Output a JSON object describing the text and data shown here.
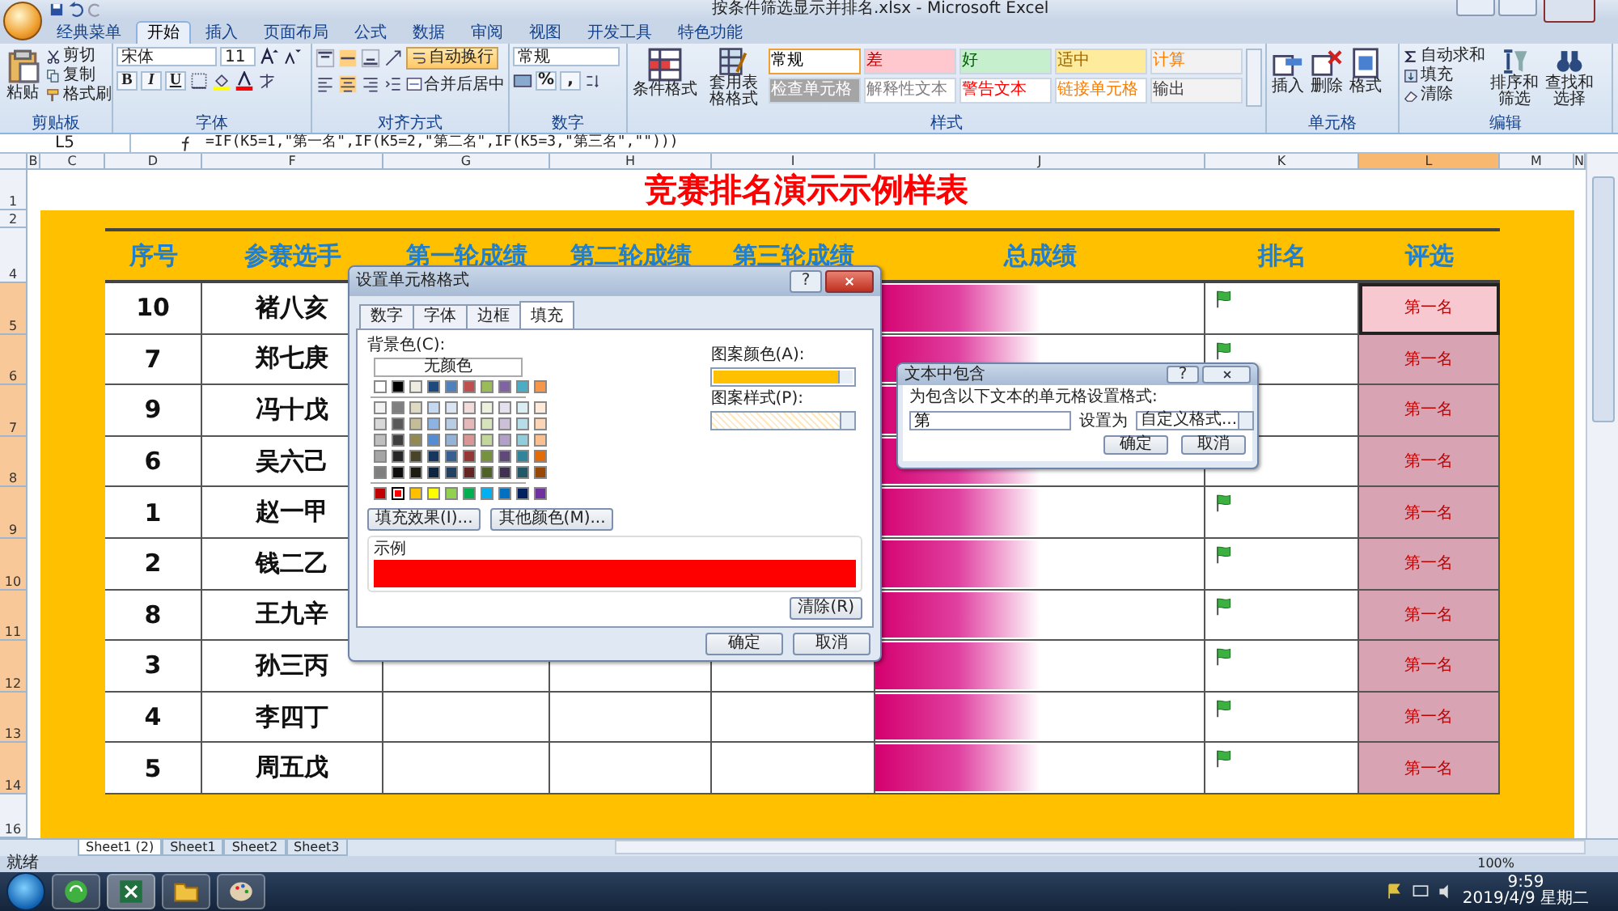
{
  "window": {
    "title": "按条件筛选显示并排名.xlsx - Microsoft Excel"
  },
  "tabs": [
    {
      "label": "经典菜单",
      "selected": false
    },
    {
      "label": "开始",
      "selected": true
    },
    {
      "label": "插入",
      "selected": false
    },
    {
      "label": "页面布局",
      "selected": false
    },
    {
      "label": "公式",
      "selected": false
    },
    {
      "label": "数据",
      "selected": false
    },
    {
      "label": "审阅",
      "selected": false
    },
    {
      "label": "视图",
      "selected": false
    },
    {
      "label": "开发工具",
      "selected": false
    },
    {
      "label": "特色功能",
      "selected": false
    }
  ],
  "ribbon": {
    "clipboard": {
      "label": "剪贴板",
      "paste": "粘贴",
      "items": [
        "剪切",
        "复制",
        "格式刷"
      ]
    },
    "font": {
      "label": "字体",
      "font": "宋体",
      "size": "11",
      "buttons": [
        "B",
        "I",
        "U"
      ]
    },
    "align": {
      "label": "对齐方式",
      "wrap": {
        "label": "自动换行",
        "on": true
      },
      "merge": "合并后居中"
    },
    "number": {
      "label": "数字",
      "format": "常规",
      "buttons": [
        "%",
        ","
      ]
    },
    "styles": {
      "label": "样式",
      "big": [
        "条件格式",
        "套用表格格式"
      ],
      "gallery": [
        {
          "label": "常规",
          "kind": "normal",
          "color": "#ffffff",
          "selected": true
        },
        {
          "label": "差",
          "kind": "bad",
          "color": "#ffc7ce",
          "selected": false
        },
        {
          "label": "好",
          "kind": "good",
          "color": "#c6efce",
          "selected": false
        },
        {
          "label": "适中",
          "kind": "neutral",
          "color": "#ffeb9c",
          "selected": false
        },
        {
          "label": "计算",
          "kind": "calculation",
          "color": "#f2f2f2",
          "selected": false
        },
        {
          "label": "检查单元格",
          "kind": "check",
          "color": "#a5a5a5",
          "selected": false
        },
        {
          "label": "解释性文本",
          "kind": "explanatory",
          "color": "#ffffff",
          "selected": false
        },
        {
          "label": "警告文本",
          "kind": "warning",
          "color": "#ffffff",
          "selected": false
        },
        {
          "label": "链接单元格",
          "kind": "linked",
          "color": "#ffffff",
          "selected": false
        },
        {
          "label": "输出",
          "kind": "output",
          "color": "#f2f2f2",
          "selected": false
        }
      ]
    },
    "cells": {
      "label": "单元格",
      "big": [
        "插入",
        "删除",
        "格式"
      ]
    },
    "editing": {
      "label": "编辑",
      "items": [
        "自动求和",
        "填充",
        "清除"
      ],
      "big": [
        "排序和筛选",
        "查找和选择"
      ]
    }
  },
  "formula_bar": {
    "name_box": "L5",
    "formula": "=IF(K5=1,\"第一名\",IF(K5=2,\"第二名\",IF(K5=3,\"第三名\",\"\")))"
  },
  "sheet": {
    "column_headers": [
      {
        "label": "B",
        "selected": false
      },
      {
        "label": "C",
        "selected": false
      },
      {
        "label": "D",
        "selected": false
      },
      {
        "label": "F",
        "selected": false
      },
      {
        "label": "G",
        "selected": false
      },
      {
        "label": "H",
        "selected": false
      },
      {
        "label": "I",
        "selected": false
      },
      {
        "label": "J",
        "selected": false
      },
      {
        "label": "K",
        "selected": false
      },
      {
        "label": "L",
        "selected": true
      },
      {
        "label": "M",
        "selected": false
      },
      {
        "label": "N",
        "selected": false
      }
    ],
    "row_headers": [
      {
        "label": "1",
        "selected": false
      },
      {
        "label": "2",
        "selected": false
      },
      {
        "label": "4",
        "selected": false
      },
      {
        "label": "5",
        "selected": true
      },
      {
        "label": "6",
        "selected": true
      },
      {
        "label": "7",
        "selected": true
      },
      {
        "label": "8",
        "selected": true
      },
      {
        "label": "9",
        "selected": true
      },
      {
        "label": "10",
        "selected": true
      },
      {
        "label": "11",
        "selected": true
      },
      {
        "label": "12",
        "selected": true
      },
      {
        "label": "13",
        "selected": true
      },
      {
        "label": "14",
        "selected": true
      },
      {
        "label": "16",
        "selected": false
      }
    ],
    "title": "竞赛排名演示示例样表",
    "columns": [
      "序号",
      "参赛选手",
      "第一轮成绩",
      "第二轮成绩",
      "第三轮成绩",
      "总成绩",
      "排名",
      "评选"
    ],
    "rows": [
      {
        "no": "10",
        "name": "褚八亥",
        "level": 0.5,
        "rating": "第一名",
        "selected": true
      },
      {
        "no": "7",
        "name": "郑七庚",
        "level": 0.5,
        "rating": "第一名",
        "selected": false
      },
      {
        "no": "9",
        "name": "冯十戊",
        "level": 0.5,
        "rating": "第一名",
        "selected": false
      },
      {
        "no": "6",
        "name": "吴六己",
        "level": 0.5,
        "rating": "第一名",
        "selected": false
      },
      {
        "no": "1",
        "name": "赵一甲",
        "level": 0.5,
        "rating": "第一名",
        "selected": false
      },
      {
        "no": "2",
        "name": "钱二乙",
        "level": 0.5,
        "rating": "第一名",
        "selected": false
      },
      {
        "no": "8",
        "name": "王九辛",
        "level": 0.5,
        "rating": "第一名",
        "selected": false
      },
      {
        "no": "3",
        "name": "孙三丙",
        "level": 0.5,
        "rating": "第一名",
        "selected": false
      },
      {
        "no": "4",
        "name": "李四丁",
        "level": 0.5,
        "rating": "第一名",
        "selected": false
      },
      {
        "no": "5",
        "name": "周五戊",
        "level": 0.5,
        "rating": "第一名",
        "selected": false
      }
    ]
  },
  "format_dialog": {
    "title": "设置单元格格式",
    "help": "?",
    "tabs": [
      {
        "label": "数字",
        "selected": false
      },
      {
        "label": "字体",
        "selected": false
      },
      {
        "label": "边框",
        "selected": false
      },
      {
        "label": "填充",
        "selected": true
      }
    ],
    "background_label": "背景色(C):",
    "no_color": "无颜色",
    "theme_colors": [
      {
        "color": "#ffffff",
        "selected": false
      },
      {
        "color": "#000000",
        "selected": false
      },
      {
        "color": "#eeece1",
        "selected": false
      },
      {
        "color": "#1f497d",
        "selected": false
      },
      {
        "color": "#4f81bd",
        "selected": false
      },
      {
        "color": "#c0504d",
        "selected": false
      },
      {
        "color": "#9bbb59",
        "selected": false
      },
      {
        "color": "#8064a2",
        "selected": false
      },
      {
        "color": "#4bacc6",
        "selected": false
      },
      {
        "color": "#f79646",
        "selected": false
      }
    ],
    "tints": [
      [
        {
          "color": "#f2f2f2",
          "selected": false
        },
        {
          "color": "#7f7f7f",
          "selected": false
        },
        {
          "color": "#ddd9c3",
          "selected": false
        },
        {
          "color": "#c6d9f0",
          "selected": false
        },
        {
          "color": "#dbe5f1",
          "selected": false
        },
        {
          "color": "#f2dcdb",
          "selected": false
        },
        {
          "color": "#ebf1dd",
          "selected": false
        },
        {
          "color": "#e5e0ec",
          "selected": false
        },
        {
          "color": "#dbeef3",
          "selected": false
        },
        {
          "color": "#fdeada",
          "selected": false
        }
      ],
      [
        {
          "color": "#d8d8d8",
          "selected": false
        },
        {
          "color": "#595959",
          "selected": false
        },
        {
          "color": "#c4bd97",
          "selected": false
        },
        {
          "color": "#8db3e2",
          "selected": false
        },
        {
          "color": "#b8cce4",
          "selected": false
        },
        {
          "color": "#e5b9b7",
          "selected": false
        },
        {
          "color": "#d7e3bc",
          "selected": false
        },
        {
          "color": "#ccc1d9",
          "selected": false
        },
        {
          "color": "#b7dde8",
          "selected": false
        },
        {
          "color": "#fbd5b5",
          "selected": false
        }
      ],
      [
        {
          "color": "#bfbfbf",
          "selected": false
        },
        {
          "color": "#3f3f3f",
          "selected": false
        },
        {
          "color": "#938953",
          "selected": false
        },
        {
          "color": "#548dd4",
          "selected": false
        },
        {
          "color": "#95b3d7",
          "selected": false
        },
        {
          "color": "#d99694",
          "selected": false
        },
        {
          "color": "#c3d69b",
          "selected": false
        },
        {
          "color": "#b2a2c7",
          "selected": false
        },
        {
          "color": "#92cddc",
          "selected": false
        },
        {
          "color": "#fac08f",
          "selected": false
        }
      ],
      [
        {
          "color": "#a5a5a5",
          "selected": false
        },
        {
          "color": "#262626",
          "selected": false
        },
        {
          "color": "#494429",
          "selected": false
        },
        {
          "color": "#17365d",
          "selected": false
        },
        {
          "color": "#366092",
          "selected": false
        },
        {
          "color": "#953734",
          "selected": false
        },
        {
          "color": "#76923c",
          "selected": false
        },
        {
          "color": "#5f497a",
          "selected": false
        },
        {
          "color": "#31859b",
          "selected": false
        },
        {
          "color": "#e36c09",
          "selected": false
        }
      ],
      [
        {
          "color": "#7f7f7f",
          "selected": false
        },
        {
          "color": "#0c0c0c",
          "selected": false
        },
        {
          "color": "#1d1b10",
          "selected": false
        },
        {
          "color": "#0f243e",
          "selected": false
        },
        {
          "color": "#244061",
          "selected": false
        },
        {
          "color": "#632423",
          "selected": false
        },
        {
          "color": "#4f6128",
          "selected": false
        },
        {
          "color": "#3f3151",
          "selected": false
        },
        {
          "color": "#205867",
          "selected": false
        },
        {
          "color": "#974806",
          "selected": false
        }
      ]
    ],
    "standard_colors": [
      {
        "color": "#c00000",
        "selected": false
      },
      {
        "color": "#ff0000",
        "selected": true
      },
      {
        "color": "#ffc000",
        "selected": false
      },
      {
        "color": "#ffff00",
        "selected": false
      },
      {
        "color": "#92d050",
        "selected": false
      },
      {
        "color": "#00b050",
        "selected": false
      },
      {
        "color": "#00b0f0",
        "selected": false
      },
      {
        "color": "#0070c0",
        "selected": false
      },
      {
        "color": "#002060",
        "selected": false
      },
      {
        "color": "#7030a0",
        "selected": false
      }
    ],
    "fill_effects": "填充效果(I)...",
    "more_colors": "其他颜色(M)...",
    "pattern_color": {
      "label": "图案颜色(A):",
      "color": "#ffc000"
    },
    "pattern_style_label": "图案样式(P):",
    "sample_label": "示例",
    "clear": "清除(R)",
    "ok": "确定",
    "cancel": "取消"
  },
  "text_dialog": {
    "title": "文本中包含",
    "help": "?",
    "prompt": "为包含以下文本的单元格设置格式:",
    "value": "第",
    "set_label": "设置为",
    "format": "自定义格式...",
    "ok": "确定",
    "cancel": "取消"
  },
  "sheet_tabs": [
    {
      "label": "Sheet1 (2)",
      "selected": true
    },
    {
      "label": "Sheet1",
      "selected": false
    },
    {
      "label": "Sheet2",
      "selected": false
    },
    {
      "label": "Sheet3",
      "selected": false
    }
  ],
  "status_bar": {
    "status": "就绪",
    "zoom": "100%"
  },
  "taskbar": {
    "time": "9:59",
    "date": "2019/4/9 星期二"
  }
}
